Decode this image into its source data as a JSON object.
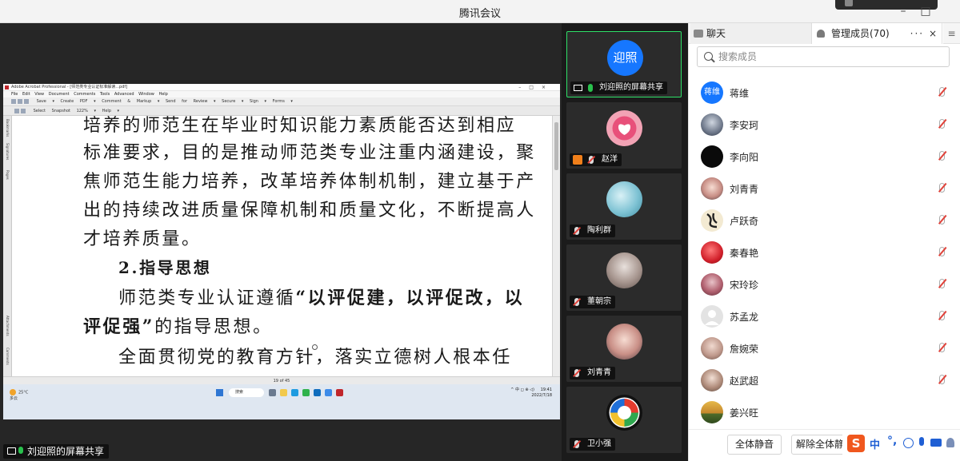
{
  "window": {
    "title": "腾讯会议"
  },
  "share": {
    "presenter_label": "刘迎照的屏幕共享",
    "document": {
      "app_title": "Adobe Acrobat Professional - [师范类专业认证标准解读...pdf]",
      "menu": [
        "File",
        "Edit",
        "View",
        "Document",
        "Comments",
        "Tools",
        "Advanced",
        "Window",
        "Help"
      ],
      "toolbar1": "Save ▾   Create PDF ▾   Comment & Markup ▾   Send for Review ▾   Secure ▾   Sign ▾   Forms ▾",
      "toolbar2": "Select   Snapshot   122% ▾   Help ▾",
      "sidebar_tabs": [
        "Bookmarks",
        "Signatures",
        "Pages",
        "Attachments",
        "Comments"
      ],
      "status": "19 of 45",
      "lines": [
        "培养的师范生在毕业时知识能力素质能否达到相应",
        "标准要求，目的是推动师范类专业注重内涵建设，聚",
        "焦师范生能力培养，改革培养体制机制，建立基于产",
        "出的持续改进质量保障机制和质量文化，不断提高人",
        "才培养质量。"
      ],
      "heading": "2.指导思想",
      "para2_start": "师范类专业认证遵循",
      "para2_bold": "“以评促建，以评促改，以",
      "para3_bold": "评促强”",
      "para3_rest": "的指导思想。",
      "para4": "全面贯彻党的教育方针，落实立德树人根本任"
    },
    "taskbar": {
      "weather_temp": "25°C",
      "weather_desc": "多云",
      "search": "搜索",
      "tray_icons": "^  中  ◻  ⊕  ◁)",
      "time": "19:41",
      "date": "2022/7/18"
    }
  },
  "video_tiles": [
    {
      "name": "刘迎照的屏幕共享",
      "avatar_text": "迎照",
      "type": "share",
      "active": true
    },
    {
      "name": "赵洋",
      "type": "host",
      "active": false
    },
    {
      "name": "陶利群",
      "type": "muted",
      "active": false
    },
    {
      "name": "董朝宗",
      "type": "muted",
      "active": false
    },
    {
      "name": "刘青青",
      "type": "muted",
      "active": false
    },
    {
      "name": "卫小强",
      "type": "muted",
      "active": false
    }
  ],
  "panel": {
    "tab_chat": "聊天",
    "tab_members": "管理成员(70)",
    "more": "···",
    "close": "×",
    "menu": "≡",
    "search_placeholder": "搜索成员",
    "members": [
      {
        "name": "蒋维",
        "avatar_text": "蒋维",
        "muted": true
      },
      {
        "name": "李安珂",
        "muted": true
      },
      {
        "name": "李向阳",
        "muted": true
      },
      {
        "name": "刘青青",
        "muted": true
      },
      {
        "name": "卢跃奇",
        "muted": true
      },
      {
        "name": "秦春艳",
        "muted": true
      },
      {
        "name": "宋玲珍",
        "muted": true
      },
      {
        "name": "苏孟龙",
        "muted": true
      },
      {
        "name": "詹婉荣",
        "muted": true
      },
      {
        "name": "赵武超",
        "muted": true
      },
      {
        "name": "姜兴旺",
        "muted": false
      }
    ],
    "mute_all": "全体静音",
    "unmute_all": "解除全体静音",
    "ime": {
      "logo": "S",
      "lang": "中",
      "punct": "°,"
    }
  },
  "colors": {
    "accent_blue": "#1677ff",
    "mic_on": "#29c14d",
    "mic_muted": "#e0423a",
    "ime_brand": "#f0571e"
  }
}
